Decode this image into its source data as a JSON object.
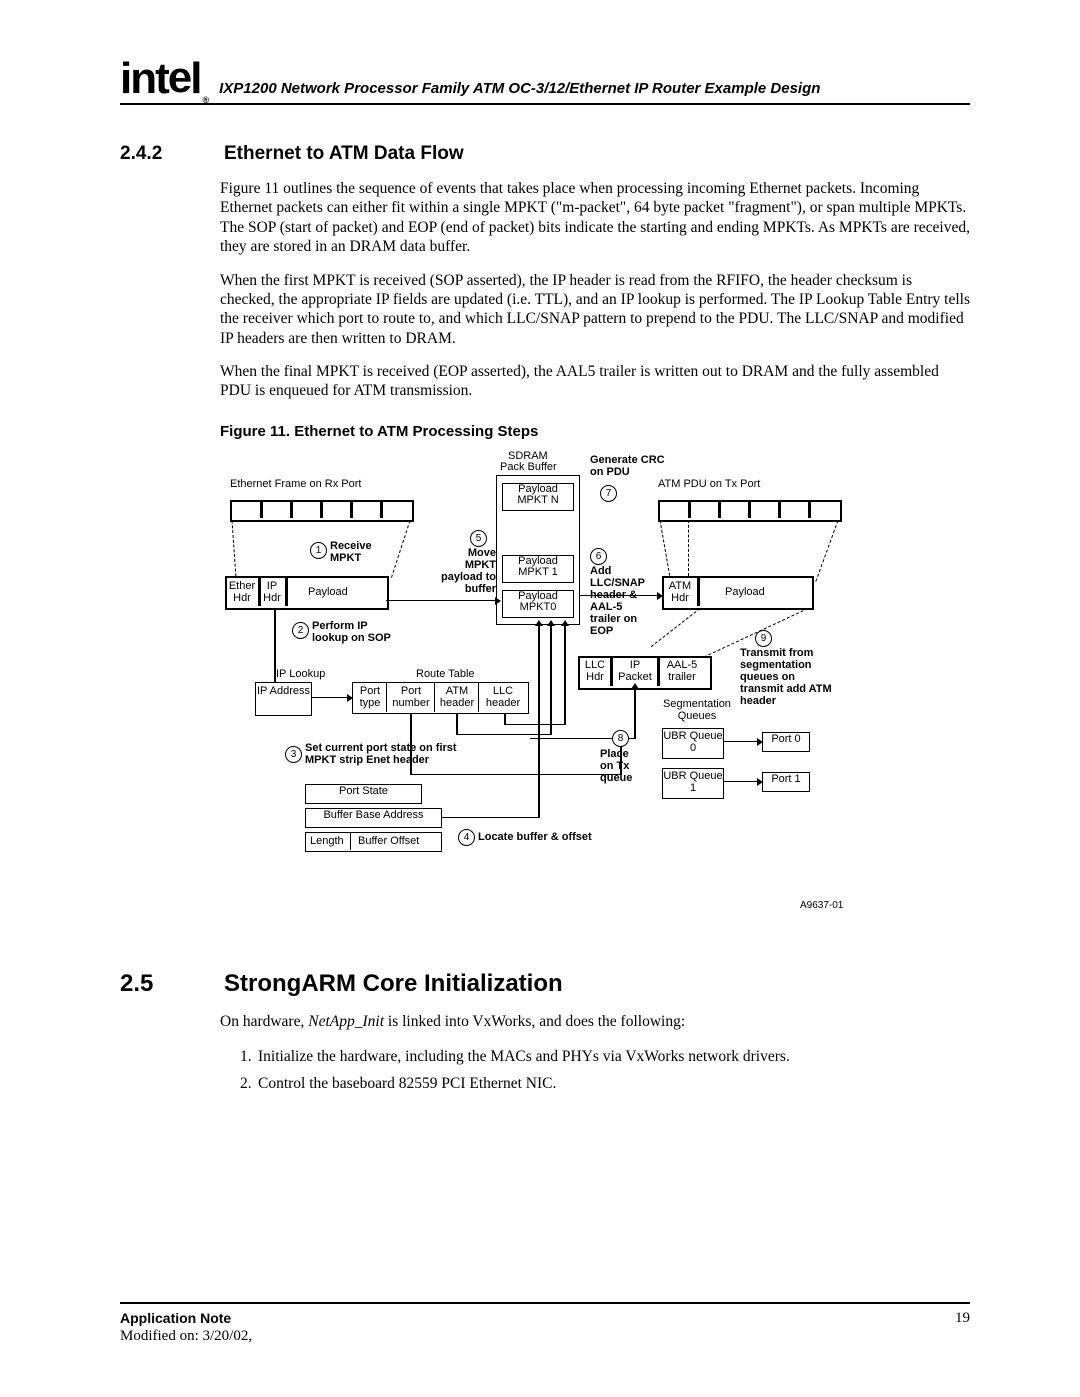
{
  "header": {
    "logo": "intel",
    "logo_reg": "®",
    "title": "IXP1200 Network Processor Family ATM OC-3/12/Ethernet IP Router Example Design"
  },
  "section_242": {
    "num": "2.4.2",
    "title": "Ethernet to ATM Data Flow",
    "p1": "Figure 11 outlines the sequence of events that takes place when processing incoming Ethernet packets. Incoming Ethernet packets can either fit within a single MPKT (\"m-packet\", 64 byte packet \"fragment\"), or span multiple MPKTs. The SOP (start of packet) and EOP (end of packet) bits indicate the starting and ending MPKTs. As MPKTs are received, they are stored in an DRAM data buffer.",
    "p2": "When the first MPKT is received (SOP asserted), the IP header is read from the RFIFO, the header checksum is checked, the appropriate IP fields are updated (i.e. TTL), and an IP lookup is performed. The IP Lookup Table Entry tells the receiver which port to route to, and which LLC/SNAP pattern to prepend to the PDU. The LLC/SNAP and modified IP headers are then written to DRAM.",
    "p3": "When the final MPKT is received (EOP asserted), the AAL5 trailer is written out to DRAM and the fully assembled PDU is enqueued for ATM transmission."
  },
  "figure11": {
    "caption": "Figure 11. Ethernet to ATM Processing Steps",
    "id": "A9637-01",
    "labels": {
      "sdram": "SDRAM",
      "pack_buffer": "Pack Buffer",
      "generate_crc": "Generate CRC on PDU",
      "eth_frame_rx": "Ethernet Frame on Rx Port",
      "payload_mpktn": "Payload MPKT N",
      "payload_mpkt1": "Payload MPKT 1",
      "payload_mpkt0": "Payload MPKT0",
      "atm_pdu_tx": "ATM PDU on Tx Port",
      "receive_mpkt": "Receive MPKT",
      "move_mpkt": "Move MPKT payload to buffer",
      "add_llc": "Add LLC/SNAP header & AAL-5 trailer on EOP",
      "ether_hdr": "Ether Hdr",
      "ip_hdr": "IP Hdr",
      "payload": "Payload",
      "atm_hdr": "ATM Hdr",
      "perform_ip": "Perform IP lookup on SOP",
      "transmit_from": "Transmit from segmentation queues on transmit add ATM header",
      "ip_lookup": "IP Lookup",
      "route_table": "Route Table",
      "llc_hdr": "LLC Hdr",
      "ip_packet": "IP Packet",
      "aal5_trailer": "AAL-5 trailer",
      "ip_address": "IP Address",
      "port_type": "Port type",
      "port_number": "Port number",
      "atm_header": "ATM header",
      "llc_header": "LLC header",
      "seg_queues": "Segmentation Queues",
      "set_port_state": "Set current port state on first MPKT strip Enet header",
      "place_tx": "Place on Tx queue",
      "ubr_q0": "UBR Queue 0",
      "ubr_q1": "UBR Queue 1",
      "port0": "Port 0",
      "port1": "Port 1",
      "port_state": "Port State",
      "buffer_base": "Buffer Base Address",
      "length": "Length",
      "buffer_offset": "Buffer Offset",
      "locate_buffer": "Locate buffer & offset"
    },
    "steps": {
      "s1": "1",
      "s2": "2",
      "s3": "3",
      "s4": "4",
      "s5": "5",
      "s6": "6",
      "s7": "7",
      "s8": "8",
      "s9": "9"
    }
  },
  "section_25": {
    "num": "2.5",
    "title": "StrongARM Core Initialization",
    "p_pre": "On hardware, ",
    "p_em": "NetApp_Init",
    "p_post": " is linked into VxWorks, and does the following:",
    "li1": "Initialize the hardware, including the MACs and PHYs via VxWorks network drivers.",
    "li2": "Control the baseboard 82559 PCI Ethernet NIC."
  },
  "footer": {
    "app_note": "Application Note",
    "modified": "Modified on: 3/20/02,",
    "page": "19"
  }
}
